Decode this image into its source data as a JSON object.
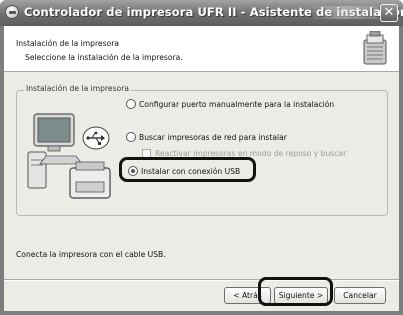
{
  "window": {
    "title": "Controlador de impresora UFR II - Asistente de instalación",
    "title_icon": "printer-driver-icon",
    "close_glyph": "✕"
  },
  "header": {
    "title": "Instalación de la impresora",
    "subtitle": "Seleccione la instalación de la impresora.",
    "icon": "printer-drive-icon"
  },
  "group": {
    "label": "Instalación de la impresora",
    "illustration": "computer-usb-printer-icon",
    "options": [
      {
        "label": "Configurar puerto manualmente para la instalación",
        "checked": false
      },
      {
        "label": "Buscar impresoras de red para instalar",
        "checked": false
      },
      {
        "label": "Instalar con conexión USB",
        "checked": true
      }
    ],
    "suboption": {
      "label": "Reactivar impresoras en modo de reposo y buscar",
      "checked": false,
      "disabled": true
    }
  },
  "footnote": "Conecta la impresora con el cable USB.",
  "buttons": {
    "back": "< Atrás",
    "next": "Siguiente >",
    "cancel": "Cancelar"
  },
  "colors": {
    "titlebar": "#6e6e6e",
    "client_bg": "#ecece6",
    "highlight": "#111111"
  }
}
